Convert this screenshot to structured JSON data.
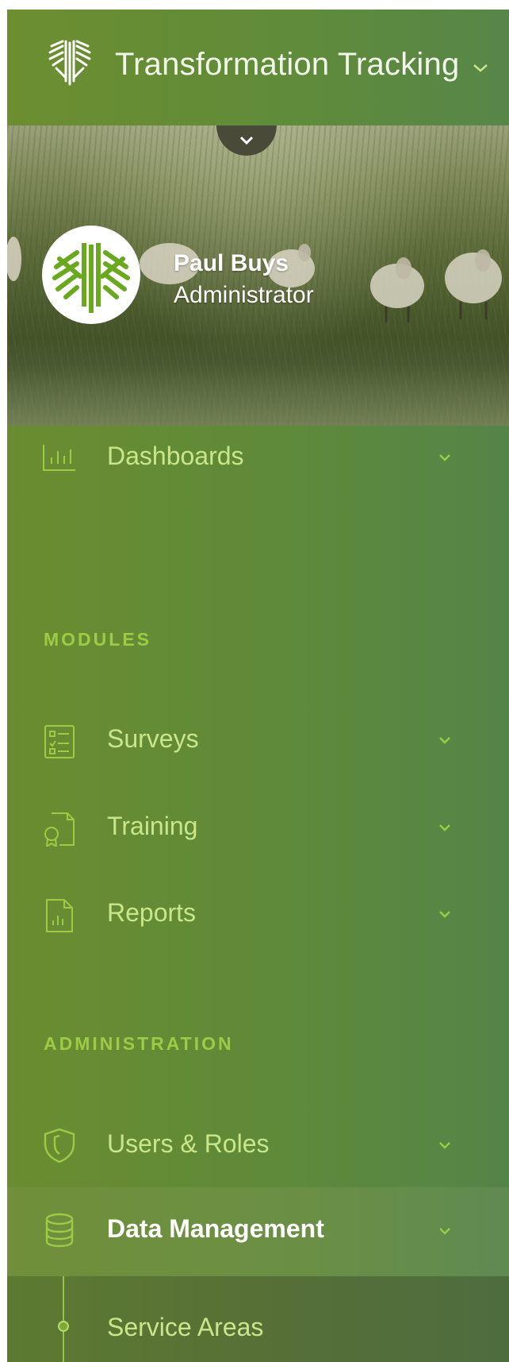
{
  "app": {
    "title": "Transformation Tracking",
    "colors": {
      "accent": "#9ccc45",
      "label": "#c9e68a",
      "sidebar": "#6b8c30"
    }
  },
  "user": {
    "name": "Paul Buys",
    "role": "Administrator"
  },
  "nav": {
    "dashboards": "Dashboards",
    "modules_heading": "MODULES",
    "surveys": "Surveys",
    "training": "Training",
    "reports": "Reports",
    "administration_heading": "ADMINISTRATION",
    "users_roles": "Users & Roles",
    "data_management": "Data Management",
    "service_areas": "Service Areas"
  },
  "icons": {
    "logo": "wool-heart-logo",
    "dashboards": "bar-chart-icon",
    "surveys": "checklist-icon",
    "training": "certificate-icon",
    "reports": "report-chart-icon",
    "users_roles": "shield-icon",
    "data_management": "database-icon",
    "chevron": "chevron-down-icon"
  }
}
